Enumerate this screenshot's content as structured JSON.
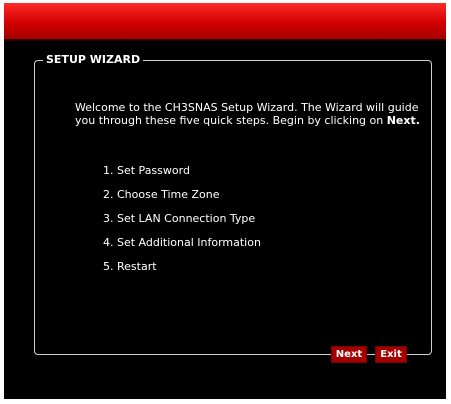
{
  "wizard": {
    "legend": "SETUP WIZARD",
    "intro_text": "Welcome to the CH3SNAS Setup Wizard. The Wizard will guide you through these five quick steps. Begin by clicking on ",
    "intro_bold": "Next.",
    "steps": [
      "1. Set Password",
      "2. Choose Time Zone",
      "3. Set LAN Connection Type",
      "4. Set Additional Information",
      "5. Restart"
    ],
    "buttons": {
      "next": "Next",
      "exit": "Exit"
    }
  },
  "colors": {
    "header_red": "#d10000",
    "button_red": "#a30000",
    "background": "#000000",
    "border": "#cfcfcf"
  }
}
